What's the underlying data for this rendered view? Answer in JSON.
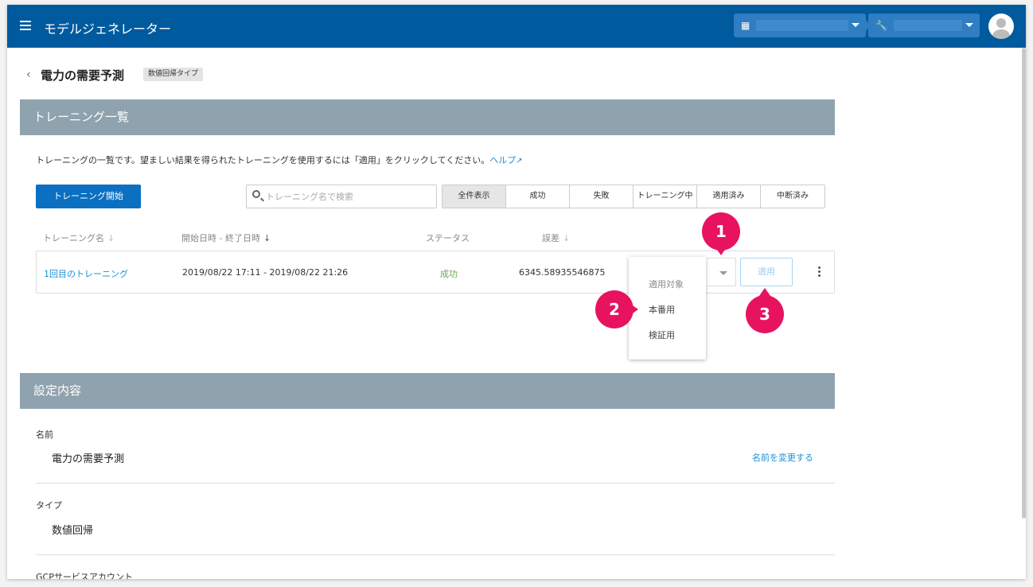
{
  "header": {
    "app_title": "モデルジェネレーター",
    "org_icon": "building-icon",
    "tool_icon": "wrench-icon",
    "accent": "#005a9e"
  },
  "page": {
    "title": "電力の需要予測",
    "type_badge": "数値回帰タイプ"
  },
  "training": {
    "section_title": "トレーニング一覧",
    "description": "トレーニングの一覧です。望ましい結果を得られたトレーニングを使用するには「適用」をクリックしてください。",
    "help_link": "ヘルプ",
    "start_button": "トレーニング開始",
    "search_placeholder": "トレーニング名で検索",
    "filters": [
      "全件表示",
      "成功",
      "失敗",
      "トレーニング中",
      "適用済み",
      "中断済み"
    ],
    "columns": {
      "name": "トレーニング名",
      "date": "開始日時 - 終了日時",
      "status": "ステータス",
      "error": "誤差"
    },
    "rows": [
      {
        "name": "1回目のトレーニング",
        "date": "2019/08/22 17:11 - 2019/08/22 21:26",
        "status": "成功",
        "error": "6345.58935546875",
        "apply": "適用"
      }
    ],
    "dropdown": {
      "header": "適用対象",
      "options": [
        "本番用",
        "検証用"
      ]
    },
    "markers": [
      "1",
      "2",
      "3"
    ]
  },
  "settings": {
    "section_title": "設定内容",
    "name_label": "名前",
    "name_value": "電力の需要予測",
    "rename_link": "名前を変更する",
    "type_label": "タイプ",
    "type_value": "数値回帰",
    "gcp_label": "GCPサービスアカウント"
  }
}
